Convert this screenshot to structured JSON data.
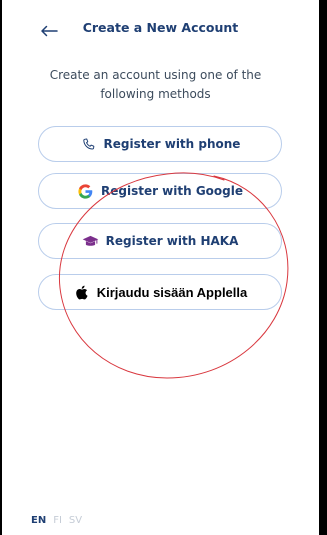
{
  "header": {
    "title": "Create a New Account",
    "back_icon": "arrow-left-icon"
  },
  "subtitle": "Create an account using one of the following methods",
  "buttons": [
    {
      "id": "phone",
      "label": "Register with phone",
      "icon": "phone-icon"
    },
    {
      "id": "google",
      "label": "Register with Google",
      "icon": "google-icon"
    },
    {
      "id": "haka",
      "label": "Register with HAKA",
      "icon": "graduation-cap-icon"
    },
    {
      "id": "apple",
      "label": "Kirjaudu sisään Applella",
      "icon": "apple-icon"
    }
  ],
  "languages": [
    {
      "code": "EN",
      "active": true
    },
    {
      "code": "FI",
      "active": false
    },
    {
      "code": "SV",
      "active": false
    }
  ],
  "colors": {
    "primary": "#1f3f73",
    "button_border": "#b9cdeb",
    "haka_purple": "#7b2f8c",
    "annotation": "#d9383f"
  }
}
